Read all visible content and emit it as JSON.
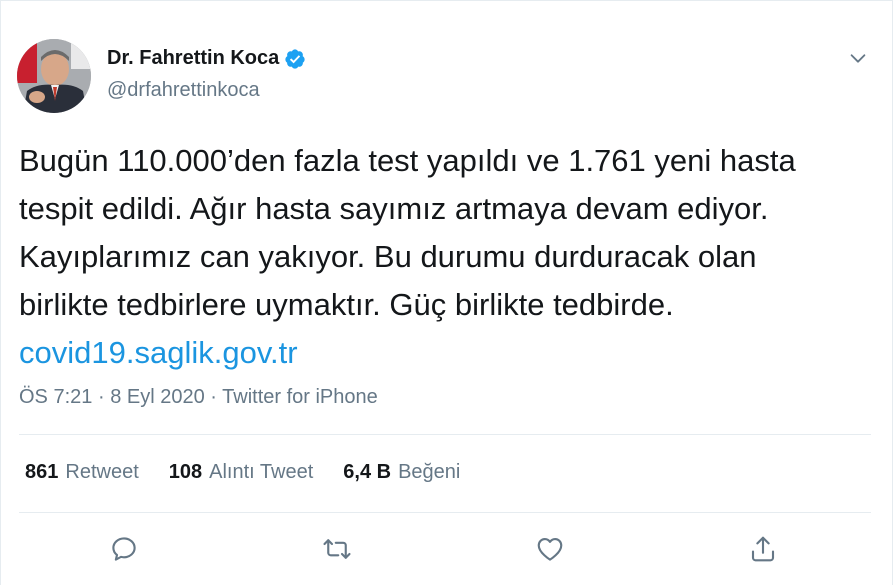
{
  "author": {
    "name": "Dr. Fahrettin Koca",
    "handle": "@drfahrettinkoca",
    "verified": true
  },
  "tweet": {
    "lines": [
      "Bugün 110.000’den fazla test yapıldı ve 1.761 yeni hasta",
      "tespit edildi. Ağır hasta sayımız artmaya devam ediyor.",
      "Kayıplarımız can yakıyor. Bu durumu durduracak olan",
      "birlikte tedbirlere uymaktır. Güç birlikte tedbirde."
    ],
    "link": "covid19.saglik.gov.tr"
  },
  "meta": {
    "time": "ÖS 7:21",
    "separator": "·",
    "date": "8 Eyl 2020",
    "source": "Twitter for iPhone"
  },
  "stats": {
    "retweets_count": "861",
    "retweets_label": "Retweet",
    "quotes_count": "108",
    "quotes_label": "Alıntı Tweet",
    "likes_count": "6,4 B",
    "likes_label": "Beğeni"
  },
  "actions": [
    "reply-icon",
    "retweet-icon",
    "like-icon",
    "share-icon"
  ],
  "colors": {
    "link": "#1b95e0",
    "secondary_text": "#657786",
    "verified_badge": "#1da1f2",
    "divider": "#e6ecf0"
  }
}
